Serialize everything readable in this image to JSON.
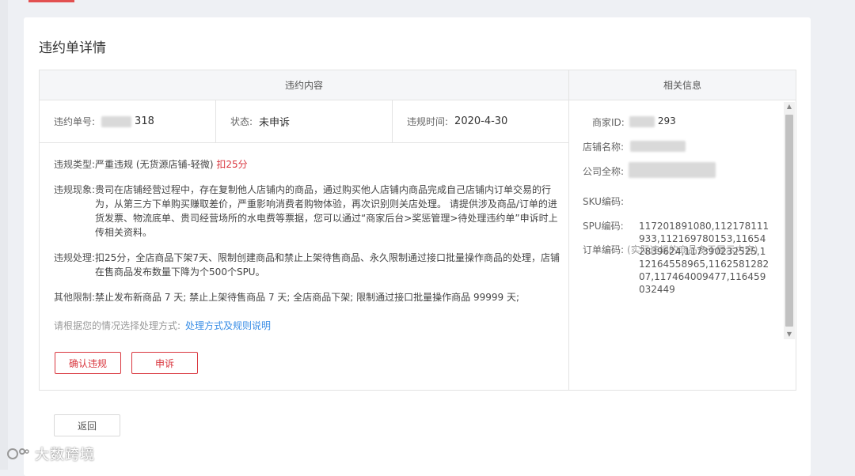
{
  "page_title": "违约单详情",
  "headers": {
    "left": "违约内容",
    "right": "相关信息"
  },
  "meta": {
    "order_no_label": "违约单号:",
    "order_no_value": "318",
    "status_label": "状态:",
    "status_value": "未申诉",
    "time_label": "违规时间:",
    "time_value": "2020-4-30"
  },
  "violation": {
    "type_label": "违规类型:",
    "type_value": "严重违规 (无货源店铺-轻微)",
    "type_penalty": "扣25分",
    "phenomenon_label": "违规现象:",
    "phenomenon_text": "贵司在店铺经营过程中，存在复制他人店铺内的商品，通过购买他人店铺内商品完成自己店铺内订单交易的行为，从第三方下单购买赚取差价，严重影响消费者购物体验，再次识别则关店处理。 请提供涉及商品/订单的进货发票、物流底单、贵司经营场所的水电费等票据，您可以通过“商家后台>奖惩管理>待处理违约单”申诉时上传相关资料。",
    "handling_label": "违规处理:",
    "handling_text": "扣25分，全店商品下架7天、限制创建商品和禁止上架待售商品、永久限制通过接口批量操作商品的处理，店铺在售商品发布数量下降为个500个SPU。",
    "other_label": "其他限制:",
    "other_text": "禁止发布新商品 7 天; 禁止上架待售商品 7 天; 全店商品下架; 限制通过接口批量操作商品 99999 天;",
    "hint_text": "请根据您的情况选择处理方式:",
    "hint_link": "处理方式及规则说明"
  },
  "buttons": {
    "confirm": "确认违规",
    "appeal": "申诉",
    "back": "返回"
  },
  "related": {
    "merchant_id_label": "商家ID:",
    "merchant_id_value": "293",
    "shop_name_label": "店铺名称:",
    "company_label": "公司全称:",
    "sku_label": "SKU编码:",
    "spu_label": "SPU编码:",
    "orders_label": "订单编码:",
    "orders_note": "(实际违规的商品多于展示内容)",
    "orders_value": "117201891080,112178111933,112169780153,116542839624,117390232525,112164558965,116258128207,117464009477,116459032449"
  },
  "watermark": "大数跨境",
  "colors": {
    "accent_red": "#d9363e",
    "link_blue": "#3a8ee6"
  }
}
